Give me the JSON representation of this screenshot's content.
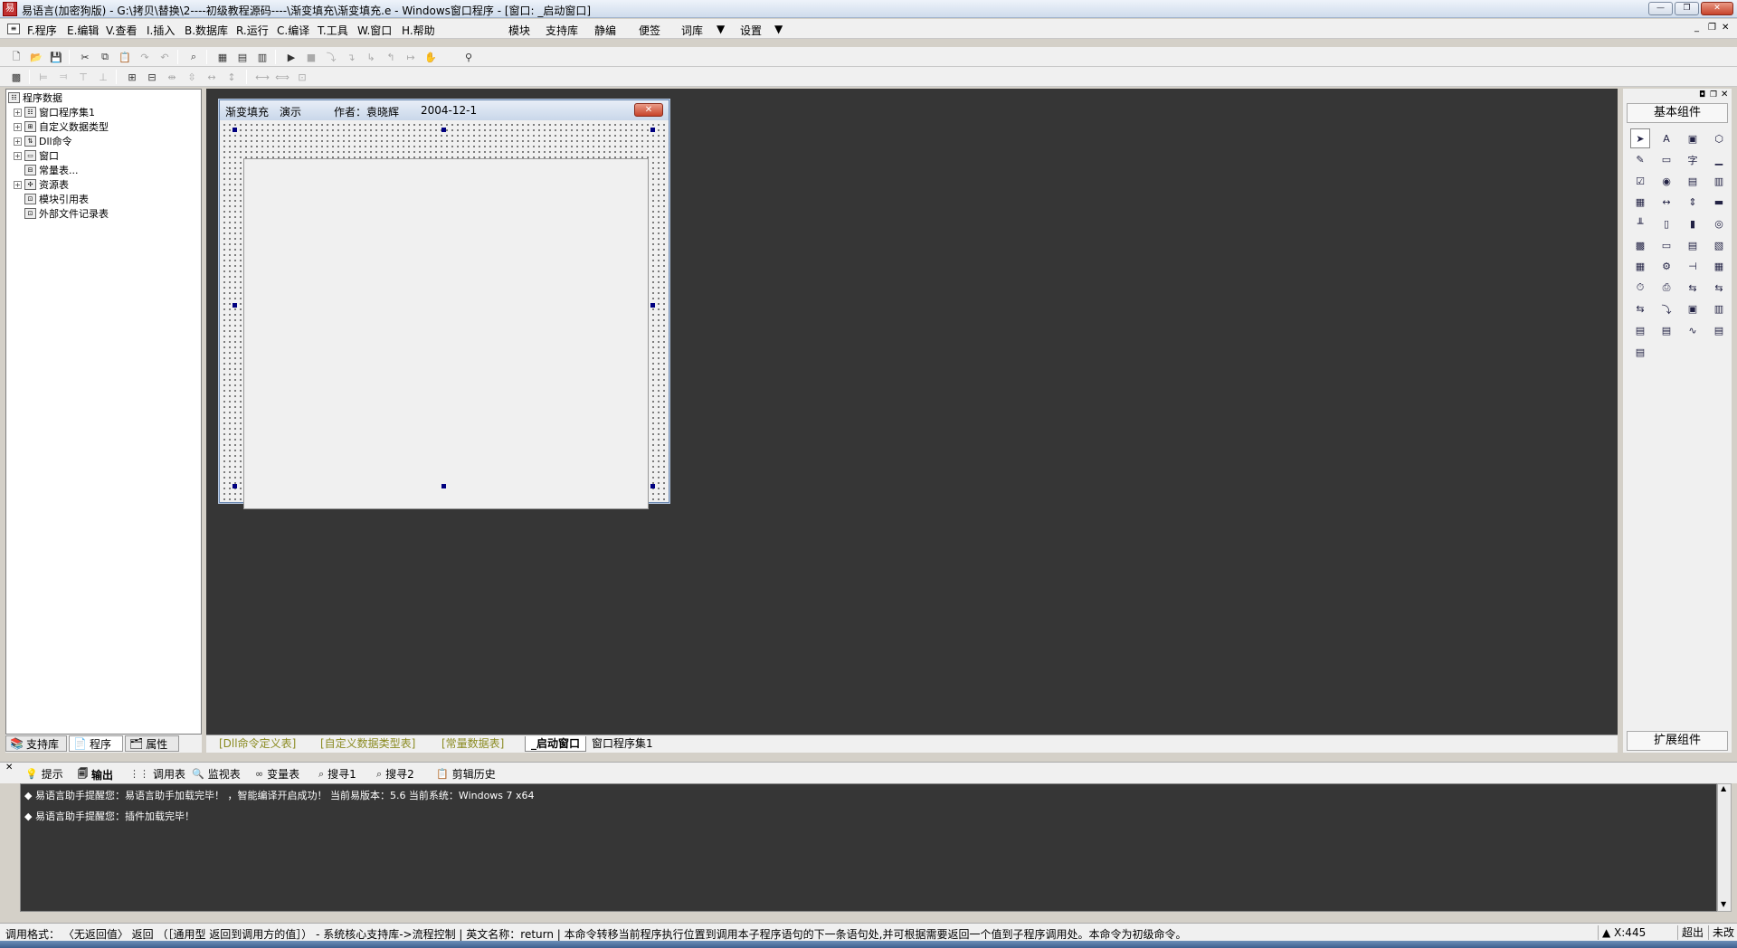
{
  "window": {
    "title": "易语言(加密狗版) - G:\\拷贝\\替换\\2----初级教程源码----\\渐变填充\\渐变填充.e - Windows窗口程序 - [窗口: _启动窗口]",
    "minimize": "—",
    "restore": "❐",
    "close": "✕"
  },
  "menu": {
    "items": [
      "F.程序",
      "E.编辑",
      "V.查看",
      "I.插入",
      "B.数据库",
      "R.运行",
      "C.编译",
      "T.工具",
      "W.窗口",
      "H.帮助"
    ],
    "extras": [
      "模块",
      "支持库",
      "静编",
      "便签",
      "词库",
      "设置"
    ]
  },
  "left_panel": {
    "tree": [
      {
        "label": "程序数据",
        "level": 0,
        "expander": ""
      },
      {
        "label": "窗口程序集1",
        "level": 1,
        "expander": "+"
      },
      {
        "label": "自定义数据类型",
        "level": 1,
        "expander": "+"
      },
      {
        "label": "Dll命令",
        "level": 1,
        "expander": "+"
      },
      {
        "label": "窗口",
        "level": 1,
        "expander": "+"
      },
      {
        "label": "常量表...",
        "level": 1,
        "expander": ""
      },
      {
        "label": "资源表",
        "level": 1,
        "expander": "+"
      },
      {
        "label": "模块引用表",
        "level": 1,
        "expander": ""
      },
      {
        "label": "外部文件记录表",
        "level": 1,
        "expander": ""
      }
    ],
    "tabs": [
      "支持库",
      "程序",
      "属性"
    ]
  },
  "design_window": {
    "title_parts": [
      "渐变填充",
      "演示",
      "作者：袁晓辉",
      "2004-12-1"
    ]
  },
  "doc_tabs": [
    "[Dll命令定义表]",
    "[自定义数据类型表]",
    "[常量数据表]",
    "_启动窗口",
    "窗口程序集1"
  ],
  "right_panel": {
    "header": "基本组件",
    "footer": "扩展组件"
  },
  "bottom_tabs": [
    "提示",
    "输出",
    "调用表",
    "监视表",
    "变量表",
    "搜寻1",
    "搜寻2",
    "剪辑历史"
  ],
  "output_lines": [
    "◆ 易语言助手提醒您：易语言助手加载完毕！ ，智能编译开启成功！ 当前易版本：5.6  当前系统：Windows 7 x64",
    "◆ 易语言助手提醒您：插件加载完毕！"
  ],
  "status": {
    "text": "调用格式： 〈无返回值〉 返回 （［通用型 返回到调用方的值］） - 系统核心支持库->流程控制  |  英文名称：return  |  本命令转移当前程序执行位置到调用本子程序语句的下一条语句处,并可根据需要返回一个值到子程序调用处。本命令为初级命令。",
    "coord": "X:445",
    "mode": "超出",
    "change": "未改"
  }
}
